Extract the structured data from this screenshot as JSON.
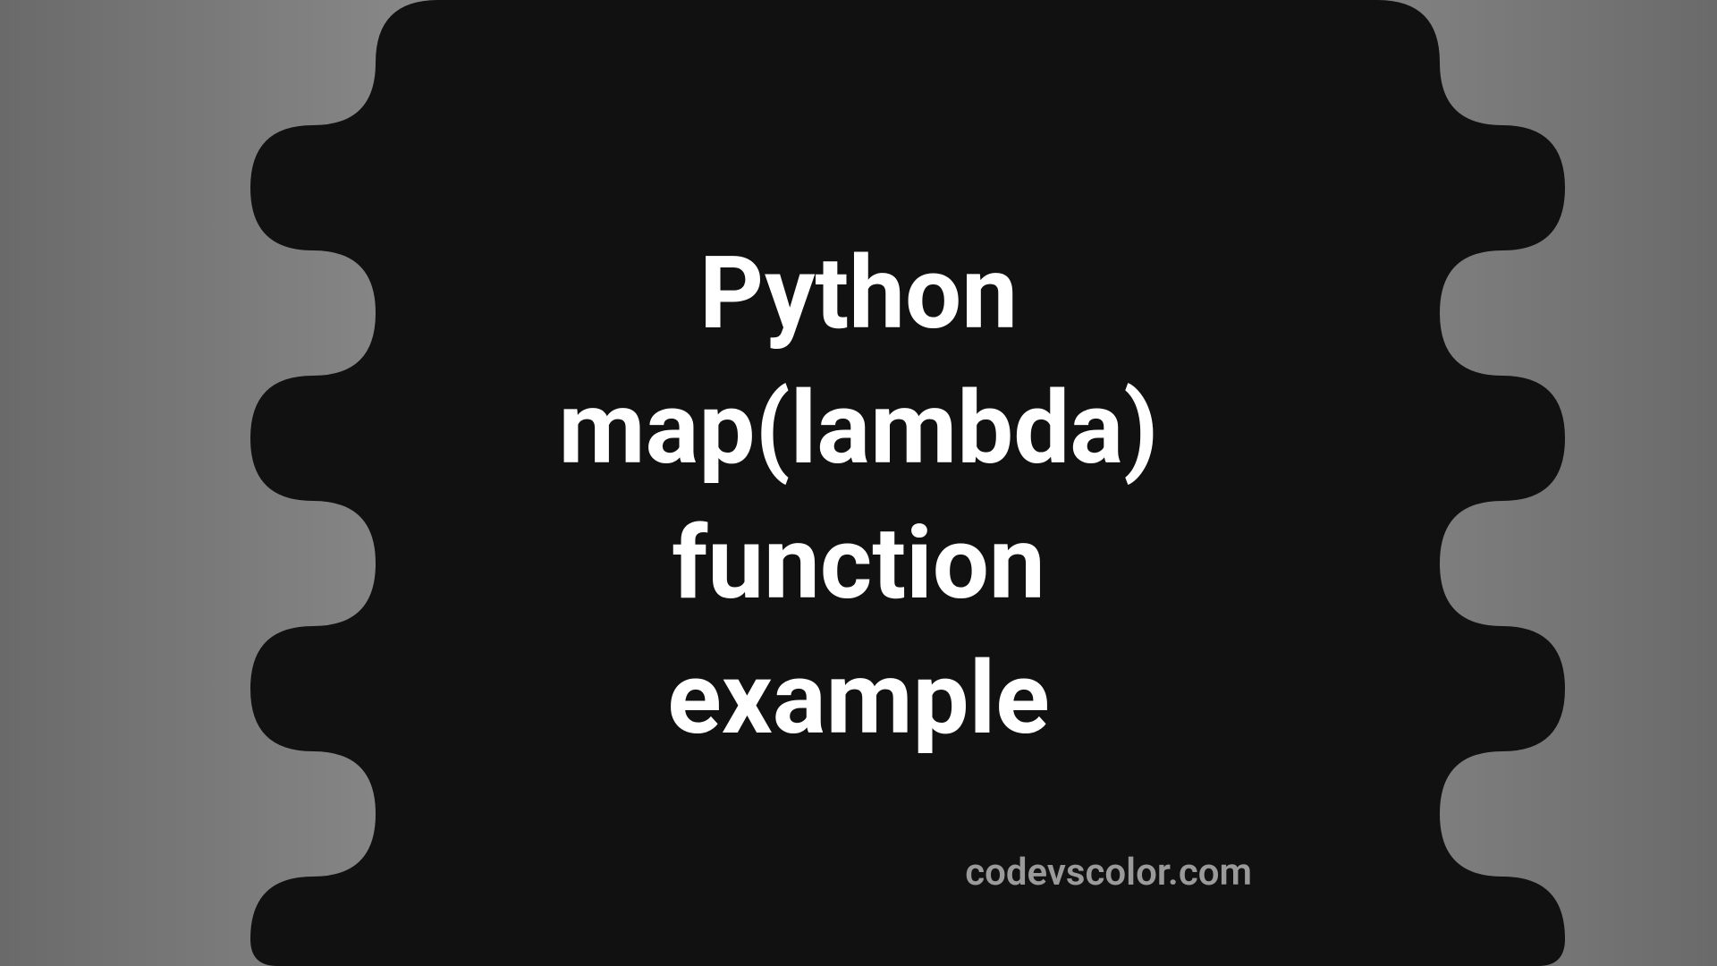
{
  "title_line_1": "Python",
  "title_line_2": "map(lambda)",
  "title_line_3": "function",
  "title_line_4": "example",
  "site_url": "codevscolor.com",
  "colors": {
    "blob_fill": "#111111",
    "text_primary": "#ffffff",
    "text_secondary": "#9a9a9a"
  }
}
